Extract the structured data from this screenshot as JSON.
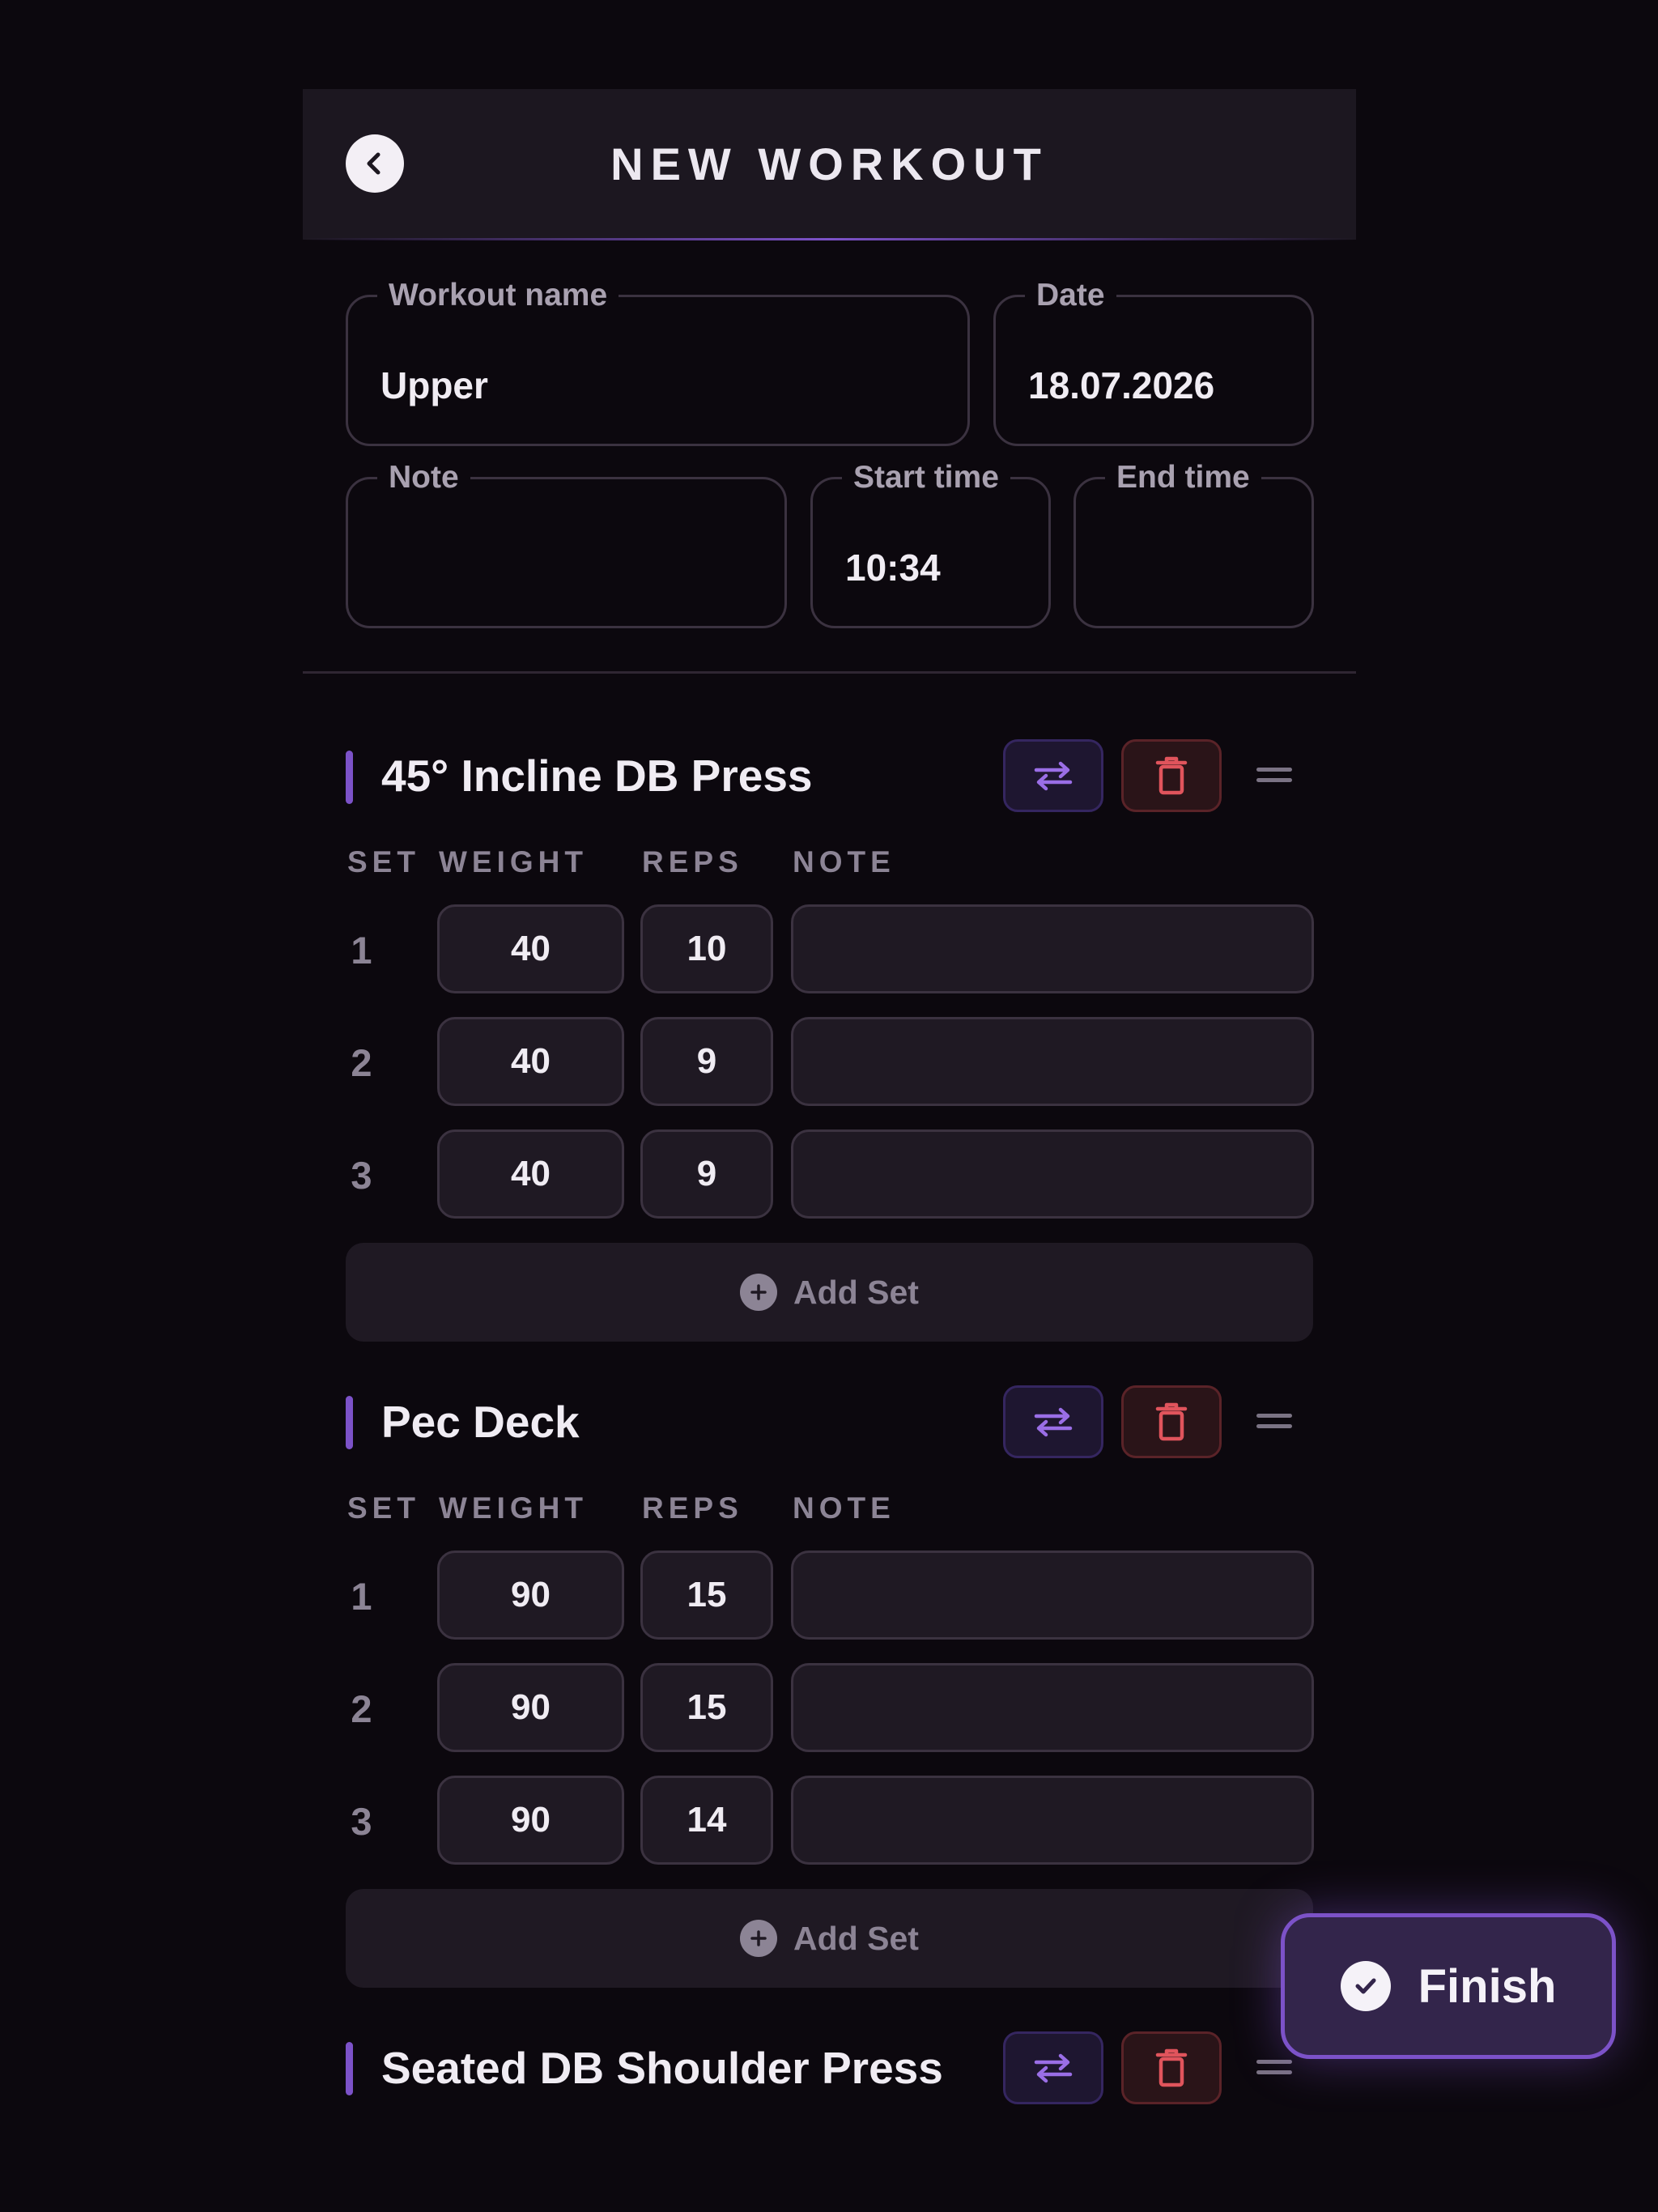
{
  "header": {
    "title": "NEW WORKOUT"
  },
  "form": {
    "workout_name": {
      "label": "Workout name",
      "value": "Upper"
    },
    "date": {
      "label": "Date",
      "value": "18.07.2026"
    },
    "note": {
      "label": "Note",
      "value": ""
    },
    "start_time": {
      "label": "Start time",
      "value": "10:34"
    },
    "end_time": {
      "label": "End time",
      "value": ""
    }
  },
  "columns": {
    "set": "SET",
    "weight": "WEIGHT",
    "reps": "REPS",
    "note": "NOTE"
  },
  "exercises": [
    {
      "name": "45° Incline DB Press",
      "sets": [
        {
          "set": "1",
          "weight": "40",
          "reps": "10",
          "note": ""
        },
        {
          "set": "2",
          "weight": "40",
          "reps": "9",
          "note": ""
        },
        {
          "set": "3",
          "weight": "40",
          "reps": "9",
          "note": ""
        }
      ],
      "add_set_label": "Add Set"
    },
    {
      "name": "Pec Deck",
      "sets": [
        {
          "set": "1",
          "weight": "90",
          "reps": "15",
          "note": ""
        },
        {
          "set": "2",
          "weight": "90",
          "reps": "15",
          "note": ""
        },
        {
          "set": "3",
          "weight": "90",
          "reps": "14",
          "note": ""
        }
      ],
      "add_set_label": "Add Set"
    },
    {
      "name": "Seated DB Shoulder Press",
      "sets": []
    }
  ],
  "finish_label": "Finish",
  "icons": {
    "back": "chevron-left-icon",
    "swap": "swap-arrows-icon",
    "delete": "trash-icon",
    "drag": "drag-handle-icon",
    "add": "plus-circle-icon",
    "finish": "check-circle-icon"
  },
  "colors": {
    "background": "#0c080e",
    "header": "#1c1720",
    "accent": "#7c52c8",
    "danger": "#e0545c",
    "cell": "#1f1923"
  }
}
